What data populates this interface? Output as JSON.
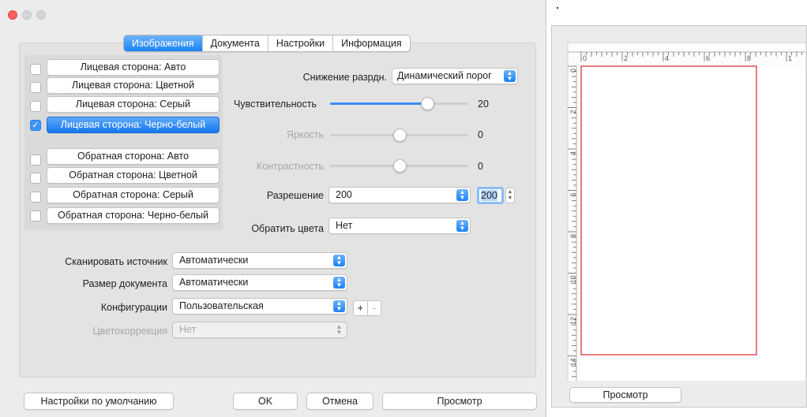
{
  "tabs": [
    "Изображения",
    "Документа",
    "Настройки",
    "Информация"
  ],
  "sides": [
    {
      "label": "Лицевая сторона: Авто",
      "checked": false,
      "selected": false
    },
    {
      "label": "Лицевая сторона: Цветной",
      "checked": false,
      "selected": false
    },
    {
      "label": "Лицевая сторона: Серый",
      "checked": false,
      "selected": false
    },
    {
      "label": "Лицевая сторона: Черно-белый",
      "checked": true,
      "selected": true
    },
    {
      "label": "Обратная сторона: Авто",
      "checked": false,
      "selected": false
    },
    {
      "label": "Обратная сторона: Цветной",
      "checked": false,
      "selected": false
    },
    {
      "label": "Обратная сторона: Серый",
      "checked": false,
      "selected": false
    },
    {
      "label": "Обратная сторона: Черно-белый",
      "checked": false,
      "selected": false
    }
  ],
  "settings": {
    "bitdepth_label": "Снижение разрдн.",
    "bitdepth_value": "Динамический порог",
    "sensitivity_label": "Чувствительность",
    "sensitivity_value": "20",
    "sensitivity_fraction": 0.7,
    "brightness_label": "Яркость",
    "brightness_value": "0",
    "brightness_fraction": 0.5,
    "contrast_label": "Контрастность",
    "contrast_value": "0",
    "contrast_fraction": 0.5,
    "resolution_label": "Разрешение",
    "resolution_value": "200",
    "resolution_field": "200",
    "invert_label": "Обратить цвета",
    "invert_value": "Нет"
  },
  "scan": {
    "source_label": "Сканировать источник",
    "source_value": "Автоматически",
    "size_label": "Размер документа",
    "size_value": "Автоматически",
    "config_label": "Конфигурации",
    "config_value": "Пользовательская",
    "plus": "+",
    "minus": "-",
    "color_label": "Цветокоррекция",
    "color_value": "Нет"
  },
  "buttons": {
    "defaults": "Настройки по умолчанию",
    "ok": "OK",
    "cancel": "Отмена",
    "preview": "Просмотр"
  },
  "preview_window": {
    "ruler_h": [
      "0",
      "2",
      "4",
      "6",
      "8",
      "1"
    ],
    "ruler_v": [
      "0",
      "2",
      "4",
      "6",
      "8",
      "10",
      "12",
      "14"
    ],
    "button": "Просмотр"
  },
  "colors": {
    "accent": "#1a82f6",
    "frame": "#d9262b"
  }
}
